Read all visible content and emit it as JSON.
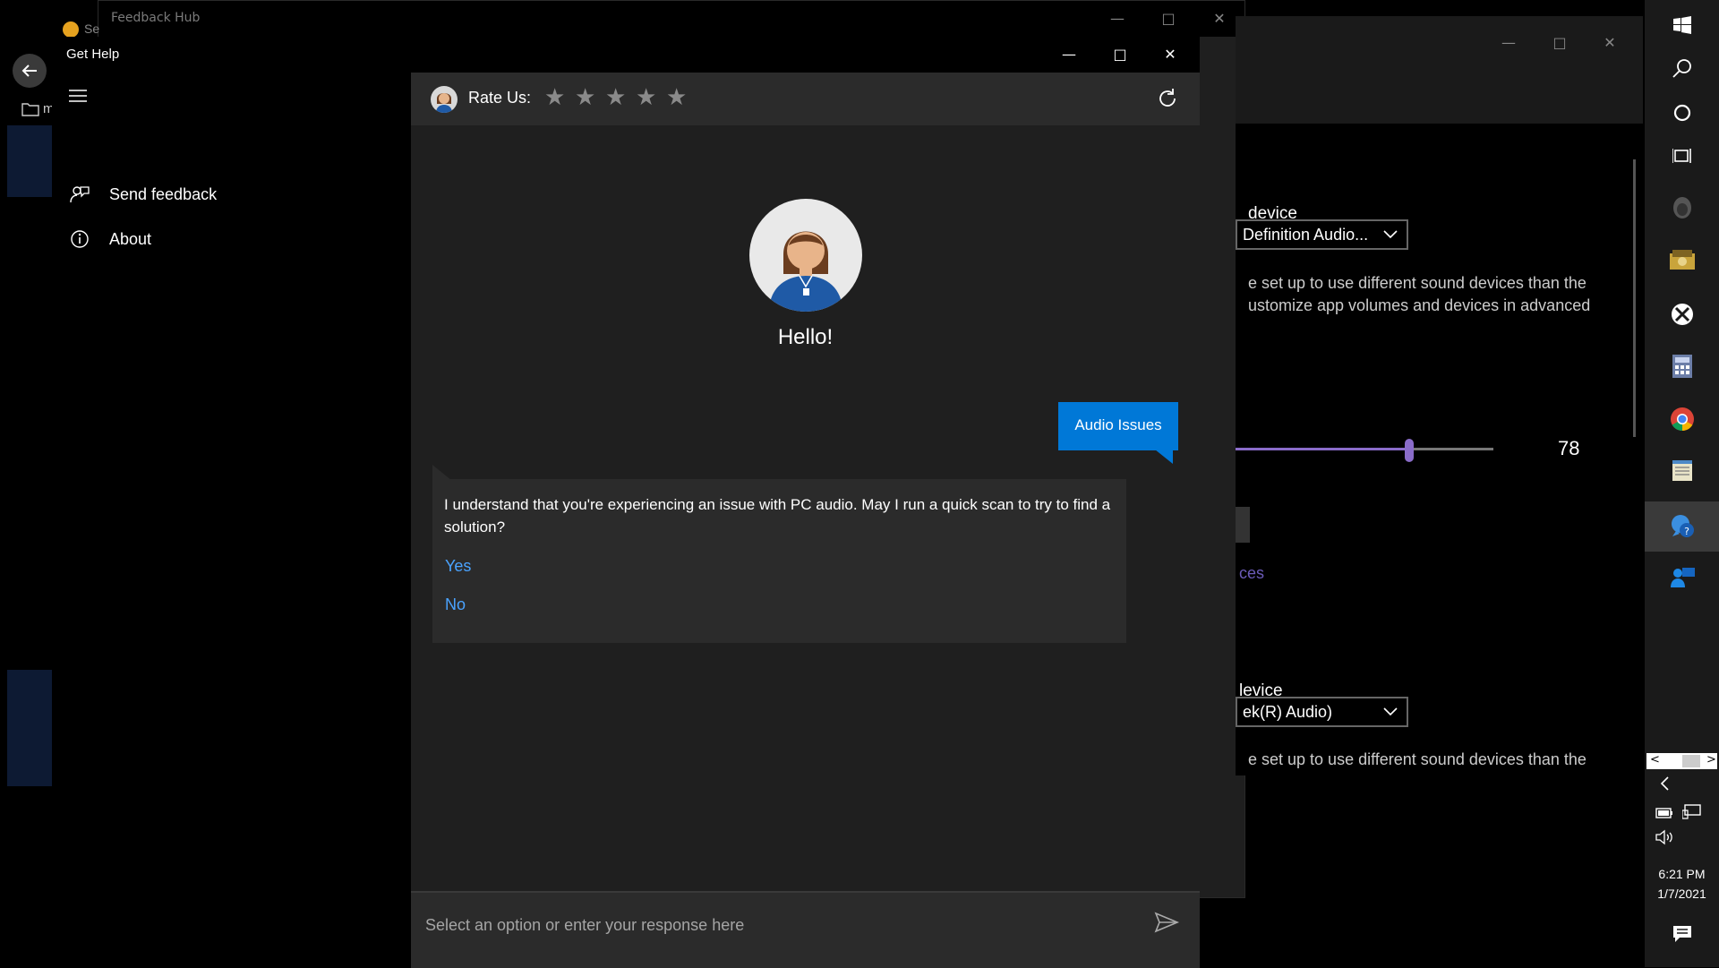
{
  "feedback_hub": {
    "title": "Feedback Hub"
  },
  "background_left": {
    "tab_label_fragment": "Se",
    "folder_label_fragment": "m"
  },
  "get_help": {
    "title": "Get Help",
    "nav": {
      "send_feedback": "Send feedback",
      "about": "About"
    },
    "rate_label": "Rate Us:",
    "star_count": 5,
    "agent_greeting": "Hello!",
    "user_message": "Audio Issues",
    "bot_message": "I understand that you're experiencing an issue with PC audio. May I run a quick scan to try to find a solution?",
    "options": [
      "Yes",
      "No"
    ],
    "input_placeholder": "Select an option or enter your response here"
  },
  "settings_window": {
    "output_label_fragment": "device",
    "output_dropdown": "Definition Audio...",
    "output_desc_line1": "e set up to use different sound devices than the",
    "output_desc_line2": "ustomize app volumes and devices in advanced",
    "volume_value": "78",
    "link_fragment": "ces",
    "input_label_fragment": "levice",
    "input_dropdown": "ek(R) Audio)",
    "input_desc_line1": "e set up to use different sound devices than the"
  },
  "taskbar": {
    "icons": [
      "windows-icon",
      "search-icon",
      "cortana-icon",
      "task-view-icon",
      "alienware-icon",
      "file-icon",
      "xbox-icon",
      "calculator-icon",
      "chrome-icon",
      "notepad-icon",
      "get-help-icon",
      "people-icon"
    ],
    "time": "6:21 PM",
    "date": "1/7/2021"
  },
  "colors": {
    "accent": "#0078d7",
    "link": "#4aa3ff",
    "chat_bg": "#1f1f1f",
    "bubble_bg": "#2b2b2b"
  }
}
